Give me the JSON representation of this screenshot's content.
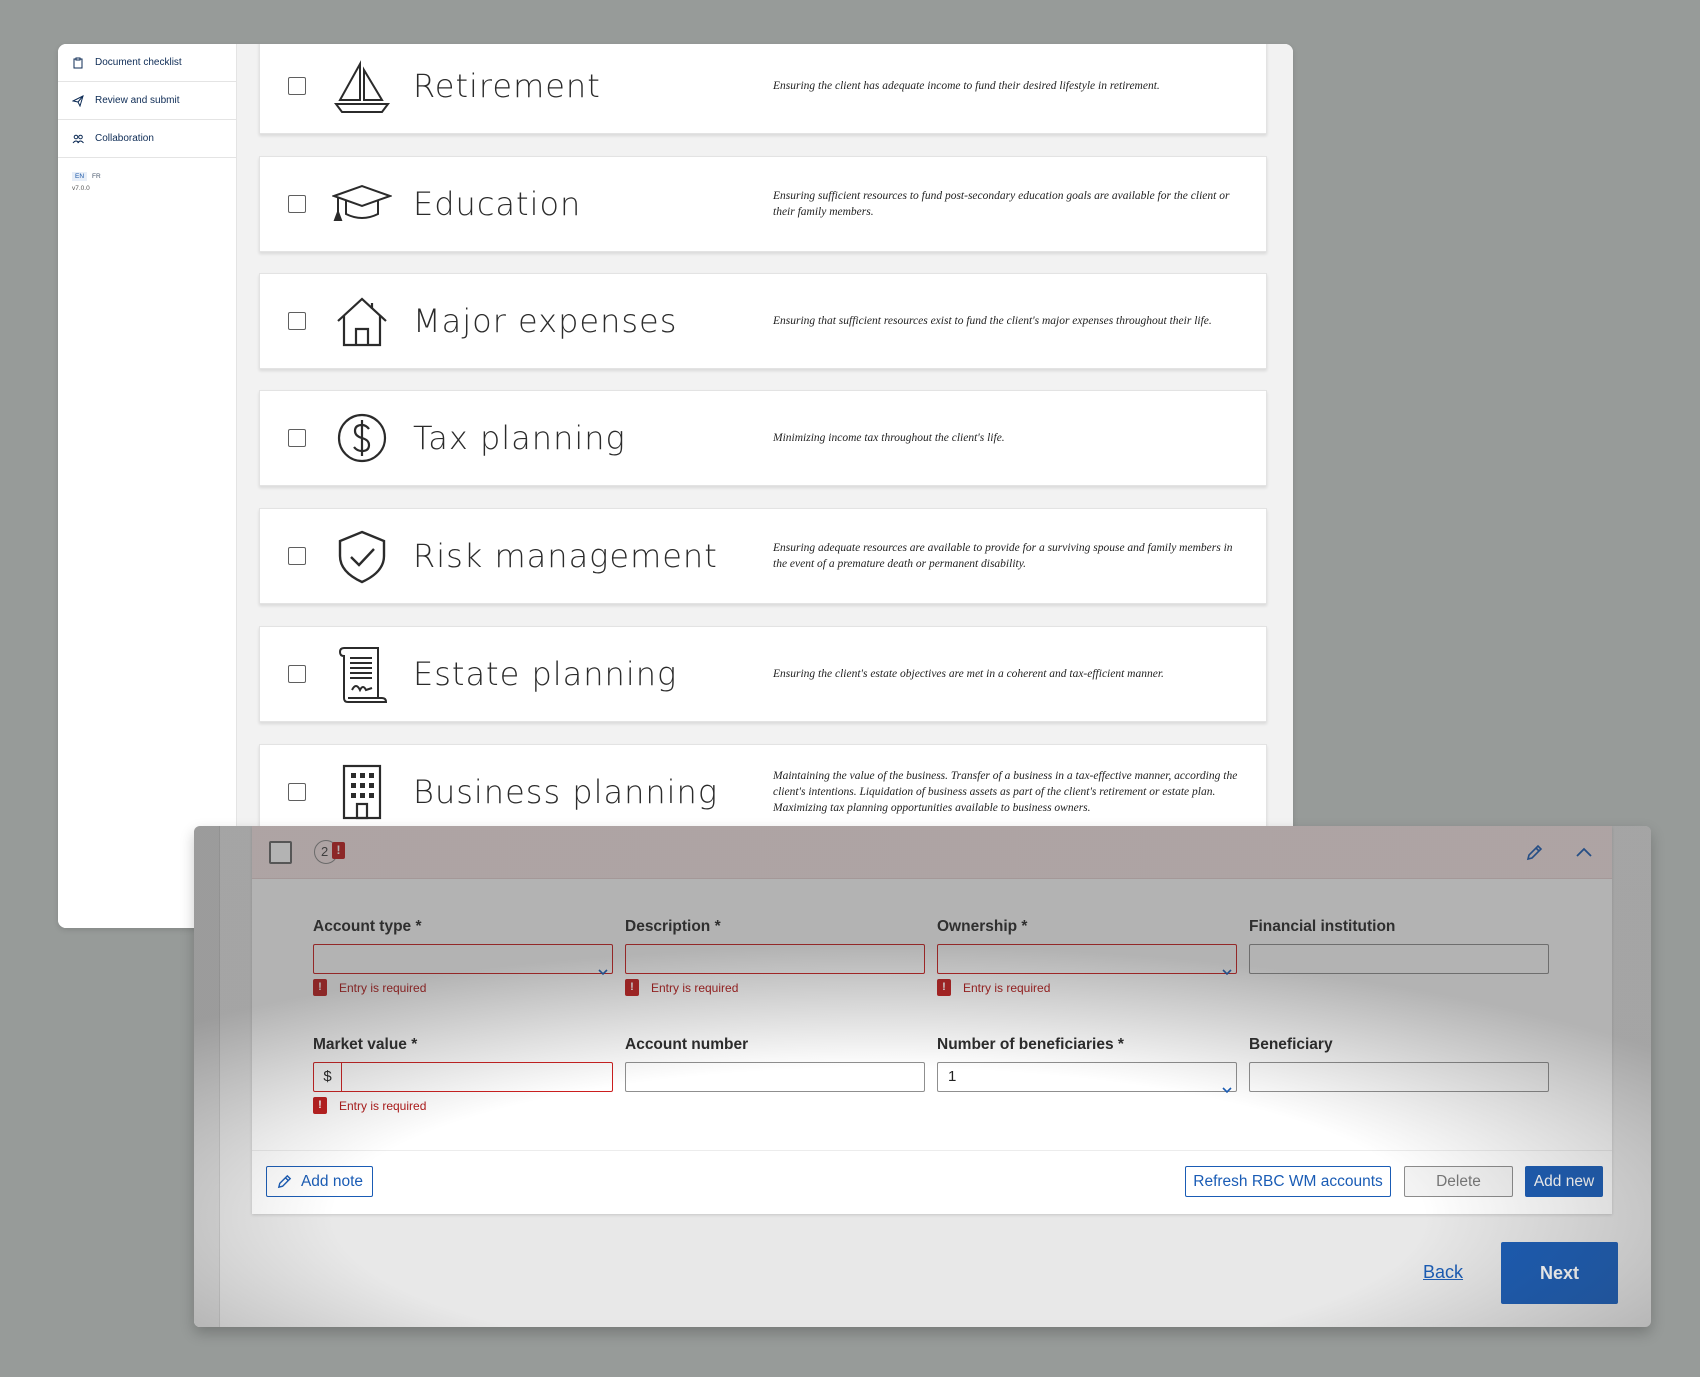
{
  "sidebar": {
    "items": [
      {
        "label": "Document checklist",
        "icon": "clipboard-icon"
      },
      {
        "label": "Review and submit",
        "icon": "send-icon"
      },
      {
        "label": "Collaboration",
        "icon": "people-icon"
      }
    ],
    "lang": [
      "EN",
      "FR"
    ],
    "version": "v7.0.0"
  },
  "goals": [
    {
      "title": "Retirement",
      "icon": "sailboat-icon",
      "desc": "Ensuring the client has adequate income to fund their desired lifestyle in retirement."
    },
    {
      "title": "Education",
      "icon": "graduation-cap-icon",
      "desc": "Ensuring sufficient resources to fund post-secondary education goals are available for the client or their family members."
    },
    {
      "title": "Major expenses",
      "icon": "house-icon",
      "desc": "Ensuring that sufficient resources exist to fund the client's major expenses throughout their life."
    },
    {
      "title": "Tax planning",
      "icon": "dollar-circle-icon",
      "desc": "Minimizing income tax throughout the client's life."
    },
    {
      "title": "Risk management",
      "icon": "shield-check-icon",
      "desc": "Ensuring adequate resources are available to provide for a surviving spouse and family members in the event of a premature death or permanent disability."
    },
    {
      "title": "Estate planning",
      "icon": "document-scroll-icon",
      "desc": "Ensuring the client's estate objectives are met in a coherent and tax-efficient manner."
    },
    {
      "title": "Business planning",
      "icon": "office-building-icon",
      "desc": "Maintaining the value of the business. Transfer of a business in a tax-effective manner, according the client's intentions. Liquidation of business assets as part of the client's retirement or estate plan. Maximizing tax planning opportunities available to business owners."
    }
  ],
  "account": {
    "count": "2",
    "error_mark": "!",
    "fields": {
      "account_type": {
        "label": "Account type *",
        "value": "",
        "error": "Entry is required"
      },
      "description": {
        "label": "Description *",
        "value": "",
        "error": "Entry is required"
      },
      "ownership": {
        "label": "Ownership *",
        "value": "",
        "error": "Entry is required"
      },
      "financial_institution": {
        "label": "Financial institution",
        "value": ""
      },
      "market_value": {
        "label": "Market value *",
        "currency": "$",
        "value": "",
        "error": "Entry is required"
      },
      "account_number": {
        "label": "Account number",
        "value": ""
      },
      "beneficiaries": {
        "label": "Number of beneficiaries *",
        "value": "1"
      },
      "beneficiary": {
        "label": "Beneficiary",
        "value": ""
      }
    },
    "buttons": {
      "add_note": "Add note",
      "refresh": "Refresh RBC WM accounts",
      "delete": "Delete",
      "add_new": "Add new"
    }
  },
  "nav": {
    "back": "Back",
    "next": "Next"
  },
  "colors": {
    "primary": "#1a5cb5",
    "error": "#c01d1d",
    "error_bg": "#f7e6e6"
  }
}
